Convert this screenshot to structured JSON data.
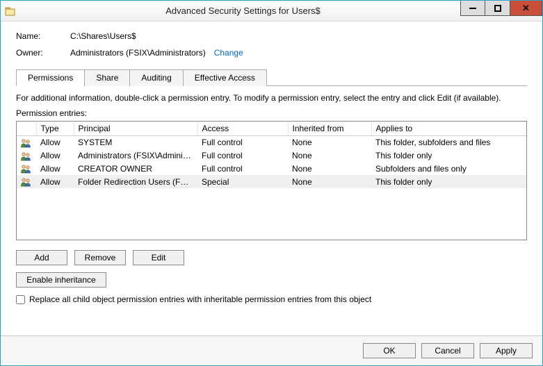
{
  "window": {
    "title": "Advanced Security Settings for Users$"
  },
  "info": {
    "name_label": "Name:",
    "name_value": "C:\\Shares\\Users$",
    "owner_label": "Owner:",
    "owner_value": "Administrators (FSIX\\Administrators)",
    "change_link": "Change"
  },
  "tabs": {
    "permissions": "Permissions",
    "share": "Share",
    "auditing": "Auditing",
    "effective": "Effective Access"
  },
  "help_text": "For additional information, double-click a permission entry. To modify a permission entry, select the entry and click Edit (if available).",
  "entries_label": "Permission entries:",
  "columns": {
    "type": "Type",
    "principal": "Principal",
    "access": "Access",
    "inherited": "Inherited from",
    "applies": "Applies to"
  },
  "rows": [
    {
      "type": "Allow",
      "principal": "SYSTEM",
      "access": "Full control",
      "inherited": "None",
      "applies": "This folder, subfolders and files"
    },
    {
      "type": "Allow",
      "principal": "Administrators (FSIX\\Adminis...",
      "access": "Full control",
      "inherited": "None",
      "applies": "This folder only"
    },
    {
      "type": "Allow",
      "principal": "CREATOR OWNER",
      "access": "Full control",
      "inherited": "None",
      "applies": "Subfolders and files only"
    },
    {
      "type": "Allow",
      "principal": "Folder Redirection Users (FSIX...",
      "access": "Special",
      "inherited": "None",
      "applies": "This folder only"
    }
  ],
  "buttons": {
    "add": "Add",
    "remove": "Remove",
    "edit": "Edit",
    "enable_inherit": "Enable inheritance",
    "ok": "OK",
    "cancel": "Cancel",
    "apply": "Apply"
  },
  "checkbox_label": "Replace all child object permission entries with inheritable permission entries from this object"
}
